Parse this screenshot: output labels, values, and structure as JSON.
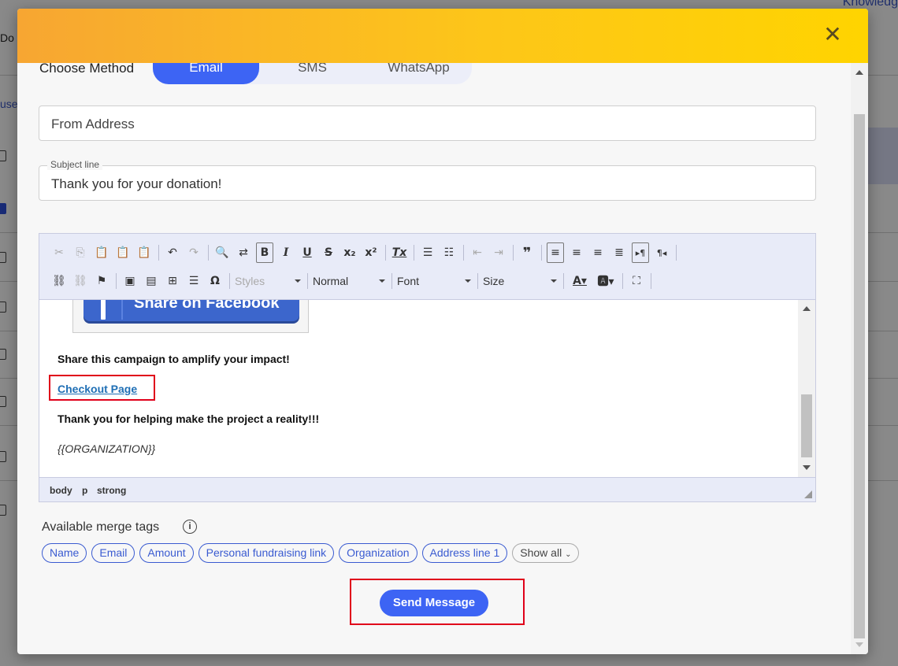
{
  "background": {
    "top_right_link": "Knowledg",
    "left_texts": [
      "Do",
      "use"
    ]
  },
  "modal": {
    "close_symbol": "✕",
    "method": {
      "label": "Choose Method",
      "tabs": [
        "Email",
        "SMS",
        "WhatsApp"
      ],
      "active": "Email"
    },
    "from_address": {
      "placeholder": "From Address"
    },
    "subject": {
      "legend": "Subject line",
      "value": "Thank you for your donation!"
    },
    "editor": {
      "toolbar": {
        "styles_label": "Styles",
        "format_label": "Normal",
        "font_label": "Font",
        "size_label": "Size"
      },
      "content": {
        "facebook_button": "Share on Facebook",
        "share_text": "Share this campaign to amplify your impact!",
        "link_text": "Checkout Page",
        "thanks_text": "Thank you for helping make the project a reality!!!",
        "org_tag": "{{ORGANIZATION}}"
      },
      "path": [
        "body",
        "p",
        "strong"
      ]
    },
    "merge_tags": {
      "label": "Available merge tags",
      "tags": [
        "Name",
        "Email",
        "Amount",
        "Personal fundraising link",
        "Organization",
        "Address line 1"
      ],
      "show_all": "Show all"
    },
    "send_button": "Send Message"
  },
  "colors": {
    "accent": "#3d64f4",
    "header_gradient_start": "#f7a632",
    "header_gradient_end": "#ffd400",
    "highlight": "#e0001a"
  }
}
